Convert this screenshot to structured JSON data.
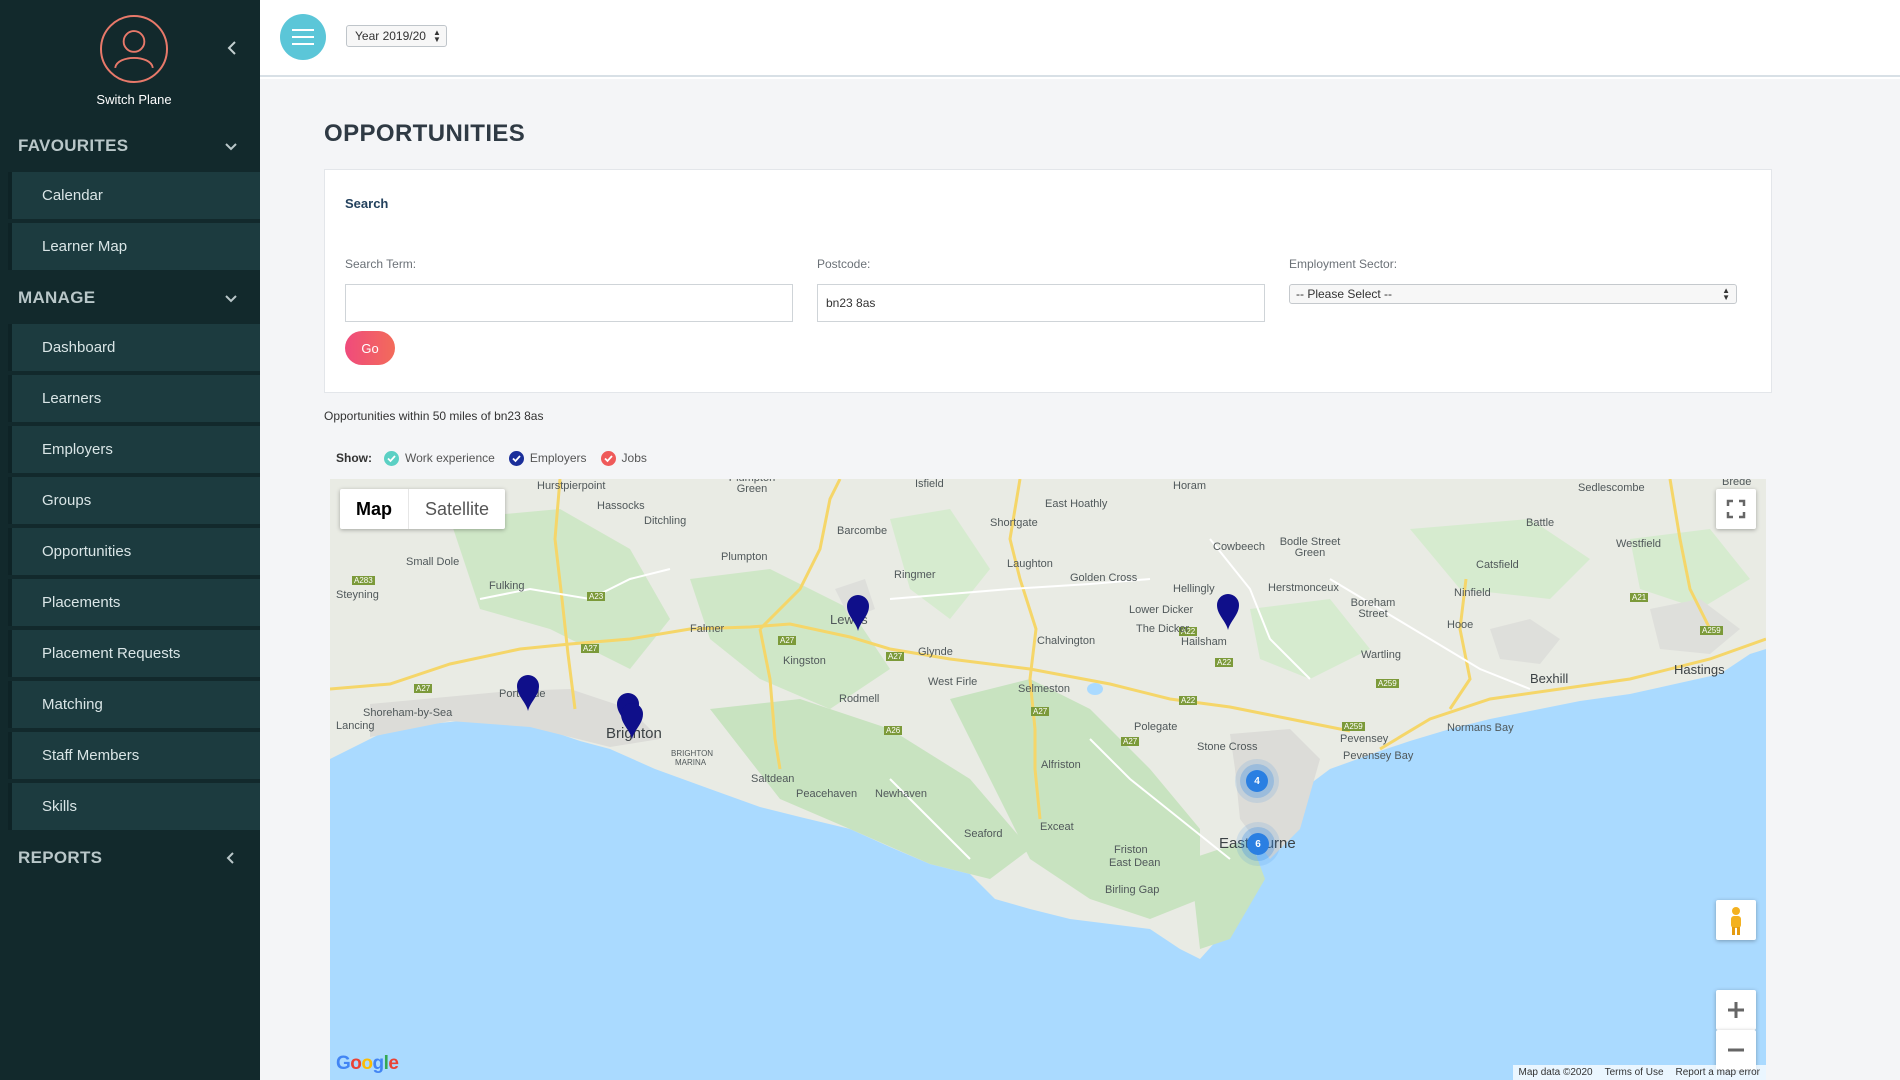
{
  "sidebar": {
    "profile_label": "Switch Plane",
    "sections": [
      {
        "label": "FAVOURITES",
        "items": [
          {
            "label": "Calendar"
          },
          {
            "label": "Learner Map"
          }
        ]
      },
      {
        "label": "MANAGE",
        "items": [
          {
            "label": "Dashboard"
          },
          {
            "label": "Learners"
          },
          {
            "label": "Employers"
          },
          {
            "label": "Groups"
          },
          {
            "label": "Opportunities"
          },
          {
            "label": "Placements"
          },
          {
            "label": "Placement Requests"
          },
          {
            "label": "Matching"
          },
          {
            "label": "Staff Members"
          },
          {
            "label": "Skills"
          }
        ]
      },
      {
        "label": "REPORTS",
        "items": []
      }
    ]
  },
  "topbar": {
    "year_select": "Year 2019/20"
  },
  "page": {
    "title": "OPPORTUNITIES",
    "search": {
      "panel_title": "Search",
      "term_label": "Search Term:",
      "term_value": "",
      "postcode_label": "Postcode:",
      "postcode_value": "bn23 8as",
      "sector_label": "Employment Sector:",
      "sector_value": "-- Please Select --",
      "go_label": "Go"
    },
    "results_text": "Opportunities within 50 miles of bn23 8as",
    "filters": {
      "label": "Show:",
      "items": [
        {
          "label": "Work experience",
          "color": "#5bd0c4"
        },
        {
          "label": "Employers",
          "color": "#1b2f9a"
        },
        {
          "label": "Jobs",
          "color": "#ef5a5a"
        }
      ]
    }
  },
  "map": {
    "type_map": "Map",
    "type_satellite": "Satellite",
    "attribution": [
      "Map data ©2020",
      "Terms of Use",
      "Report a map error"
    ],
    "clusters": [
      {
        "count": "4"
      },
      {
        "count": "6"
      }
    ],
    "places": {
      "hurstpierpoint": "Hurstpierpoint",
      "hassocks": "Hassocks",
      "ditchling": "Ditchling",
      "plumpton_green": "Plumpton Green",
      "isfield": "Isfield",
      "east_hoathly": "East Hoathly",
      "horam": "Horam",
      "sedlescombe": "Sedlescombe",
      "brede": "Brede",
      "barcombe": "Barcombe",
      "shortgate": "Shortgate",
      "battle": "Battle",
      "cowbeech": "Cowbeech",
      "bodle_street": "Bodle Street Green",
      "westfield": "Westfield",
      "small_dole": "Small Dole",
      "plumpton": "Plumpton",
      "laughton": "Laughton",
      "catsfield": "Catsfield",
      "steyning": "Steyning",
      "fulking": "Fulking",
      "ringmer": "Ringmer",
      "golden_cross": "Golden Cross",
      "hellingly": "Hellingly",
      "herstmonceux": "Herstmonceux",
      "ninfield": "Ninfield",
      "lower_dicker": "Lower Dicker",
      "boreham_street": "Boreham Street",
      "lewes": "Lewes",
      "falmer": "Falmer",
      "the_dicker": "The Dicker",
      "hoathly_hoe": "Hooe",
      "chalvington": "Chalvington",
      "hailsham": "Hailsham",
      "kingston": "Kingston",
      "glynde": "Glynde",
      "wartling": "Wartling",
      "hastings": "Hastings",
      "bexhill": "Bexhill",
      "portslade": "Portslade",
      "west_firle": "West Firle",
      "selmeston": "Selmeston",
      "shoreham": "Shoreham-by-Sea",
      "lancing": "Lancing",
      "rodmell": "Rodmell",
      "normans_bay": "Normans Bay",
      "pevensey": "Pevensey",
      "brighton": "Brighton",
      "polegate": "Polegate",
      "pevensey_bay": "Pevensey Bay",
      "brighton_marina": "BRIGHTON",
      "brighton_marina2": "MARINA",
      "stone_cross": "Stone Cross",
      "alfriston": "Alfriston",
      "saltdean": "Saltdean",
      "peacehaven": "Peacehaven",
      "newhaven": "Newhaven",
      "exceat": "Exceat",
      "seaford": "Seaford",
      "eastbourne": "Eastbourne",
      "friston": "Friston",
      "east_dean": "East Dean",
      "birling_gap": "Birling Gap"
    },
    "roads": [
      "A283",
      "A23",
      "A27",
      "A27",
      "A27",
      "A27",
      "A26",
      "A27",
      "A27",
      "A22",
      "A22",
      "A21",
      "A259",
      "A259",
      "A259",
      "A22"
    ]
  }
}
